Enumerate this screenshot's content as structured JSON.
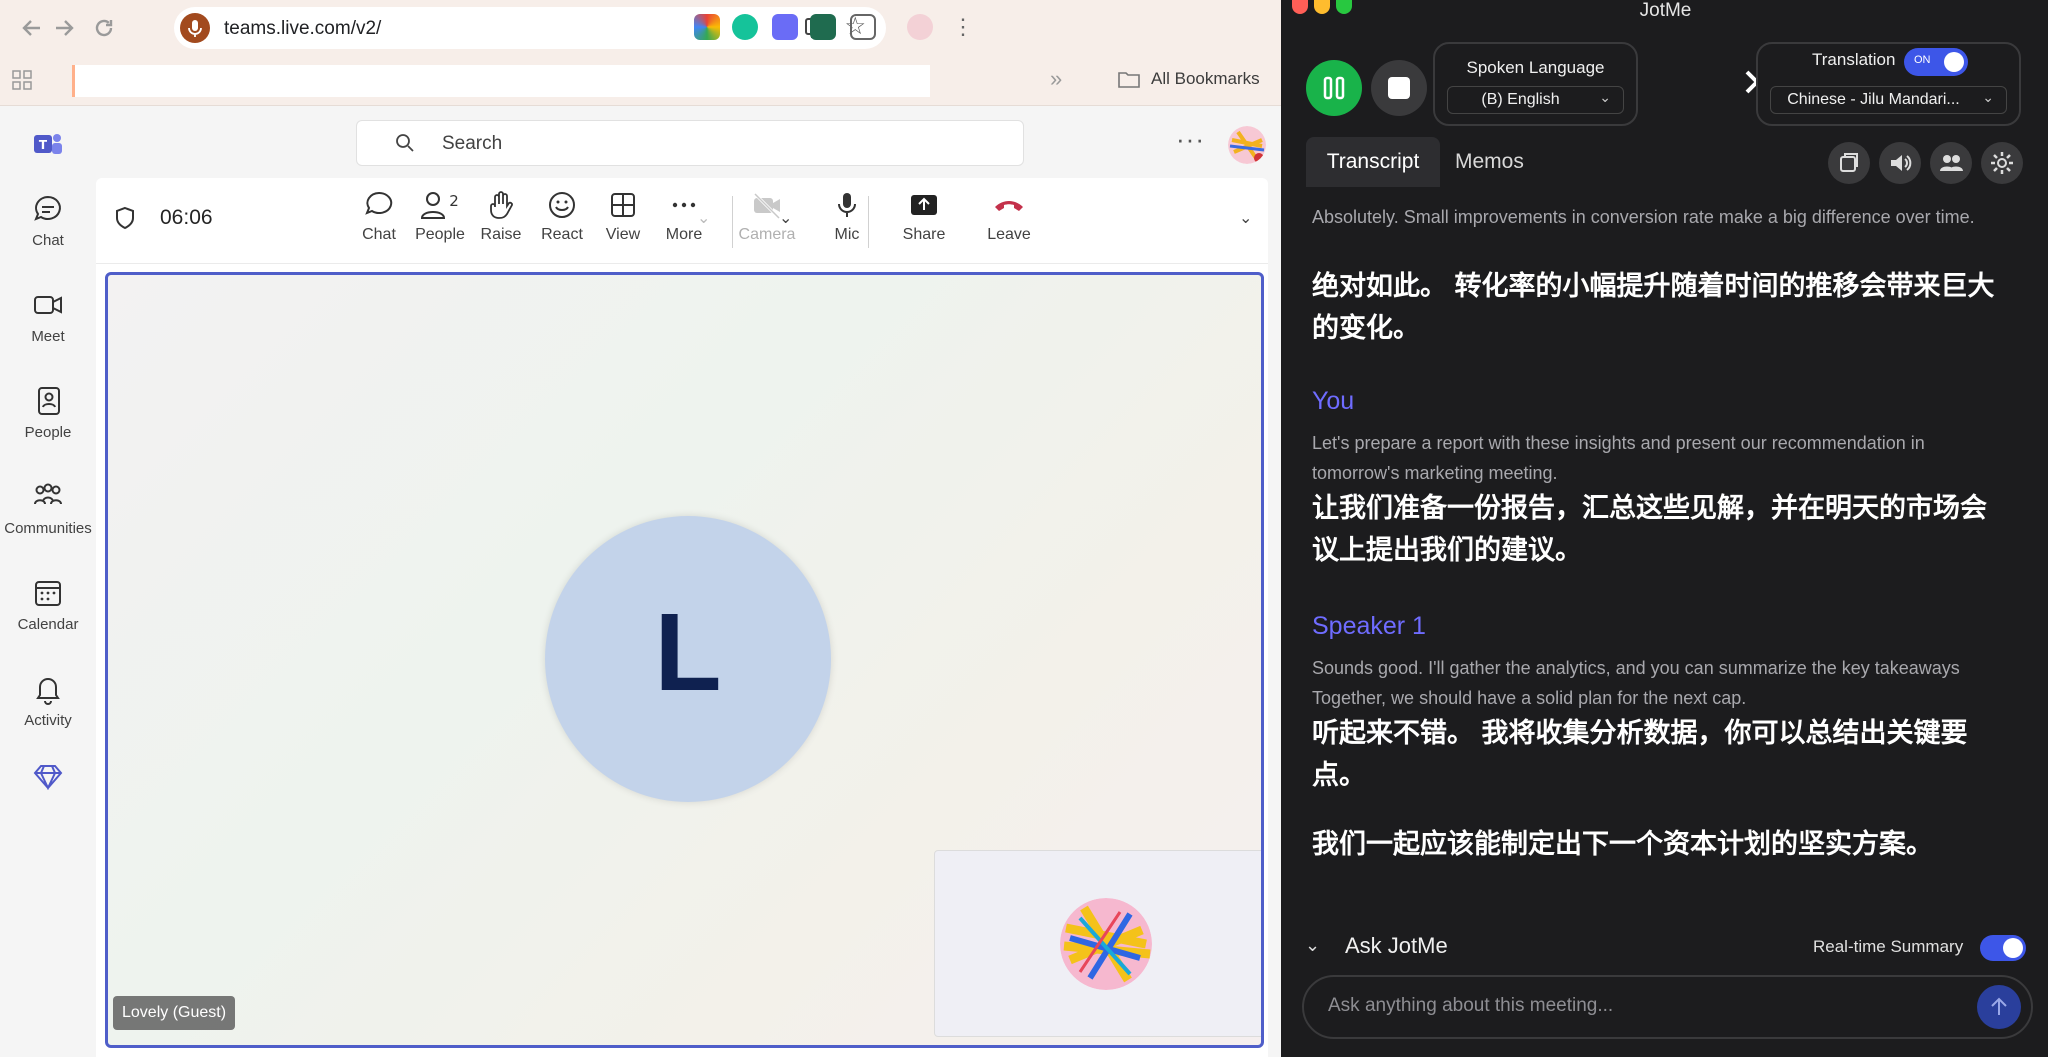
{
  "browser": {
    "url": "teams.live.com/v2/",
    "bookmarks_label": "All Bookmarks",
    "bookmarks_overflow": "»"
  },
  "teams": {
    "search_placeholder": "Search",
    "more_label": "···",
    "rail": [
      {
        "label": "Chat",
        "icon": "chat-icon"
      },
      {
        "label": "Meet",
        "icon": "meet-icon"
      },
      {
        "label": "People",
        "icon": "people-icon"
      },
      {
        "label": "Communities",
        "icon": "communities-icon"
      },
      {
        "label": "Calendar",
        "icon": "calendar-icon"
      },
      {
        "label": "Activity",
        "icon": "activity-icon"
      }
    ],
    "call": {
      "timer": "06:06",
      "people_count": "2",
      "toolbar": {
        "chat": "Chat",
        "people": "People",
        "raise": "Raise",
        "react": "React",
        "view": "View",
        "more": "More",
        "camera": "Camera",
        "mic": "Mic",
        "share": "Share",
        "leave": "Leave"
      },
      "participant_initial": "L",
      "participant_tag": "Lovely (Guest)"
    }
  },
  "jotme": {
    "title": "JotMe",
    "spoken_language_title": "Spoken Language",
    "spoken_language_value": "(B) English",
    "translation_title": "Translation",
    "translation_toggle": "ON",
    "translation_value": "Chinese - Jilu Mandari...",
    "tabs": [
      "Transcript",
      "Memos"
    ],
    "transcript": [
      {
        "speaker": "",
        "en": "Absolutely. Small improvements in conversion rate make a big difference over time.",
        "zh": "绝对如此。 转化率的小幅提升随着时间的推移会带来巨大的变化。"
      },
      {
        "speaker": "You",
        "en": "Let's prepare a report with these insights and present our recommendation in tomorrow's marketing meeting.",
        "zh": "让我们准备一份报告，汇总这些见解，并在明天的市场会议上提出我们的建议。"
      },
      {
        "speaker": "Speaker 1",
        "en": "Sounds good. I'll gather the analytics, and you can summarize the key takeaways Together, we should have a solid plan for the next cap.",
        "zh": "听起来不错。 我将收集分析数据，你可以总结出关键要点。",
        "zh2": "我们一起应该能制定出下一个资本计划的坚实方案。"
      }
    ],
    "ask_title": "Ask JotMe",
    "realtime_summary_label": "Real-time Summary",
    "ask_placeholder": "Ask anything about this meeting..."
  },
  "colors": {
    "teams_accent": "#4f5ec9",
    "jotme_accent": "#6f6cff",
    "record_green": "#19b34a",
    "leave_red": "#c4314b"
  }
}
